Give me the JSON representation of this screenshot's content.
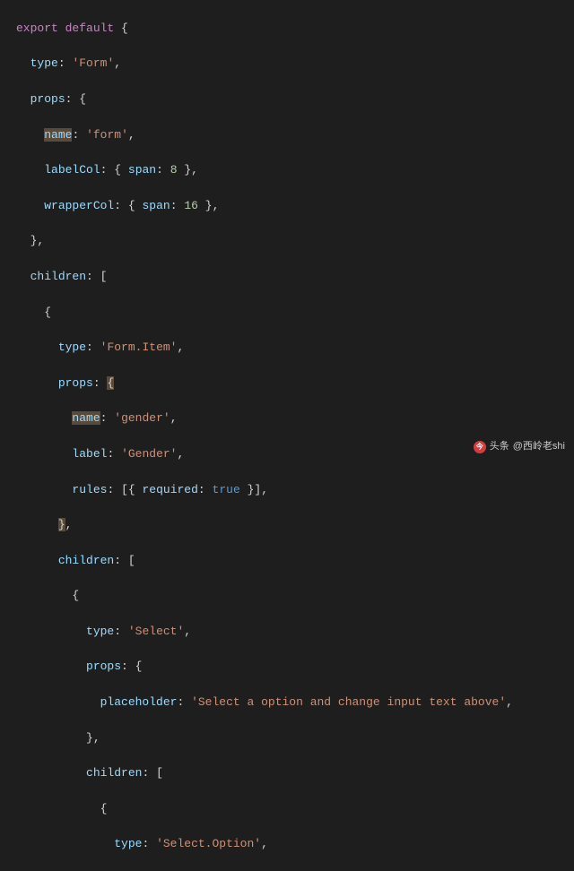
{
  "code": {
    "l1_export": "export",
    "l1_default": "default",
    "l2_type": "type",
    "l2_val": "'Form'",
    "l3_props": "props",
    "l4_name": "name",
    "l4_val": "'form'",
    "l5_labelCol": "labelCol",
    "l5_span": "span",
    "l5_num": "8",
    "l6_wrapperCol": "wrapperCol",
    "l6_span": "span",
    "l6_num": "16",
    "l8_children": "children",
    "l10_type": "type",
    "l10_val": "'Form.Item'",
    "l11_props": "props",
    "l12_name": "name",
    "l12_val": "'gender'",
    "l13_label": "label",
    "l13_val": "'Gender'",
    "l14_rules": "rules",
    "l14_required": "required",
    "l14_true": "true",
    "l16_children": "children",
    "l18_type": "type",
    "l18_val": "'Select'",
    "l19_props": "props",
    "l20_placeholder": "placeholder",
    "l20_val": "'Select a option and change input text above'",
    "l22_children": "children",
    "l24_type": "type",
    "l24_val": "'Select.Option'"
  },
  "watermark": {
    "prefix": "头条",
    "author": "@西岭老shi"
  }
}
